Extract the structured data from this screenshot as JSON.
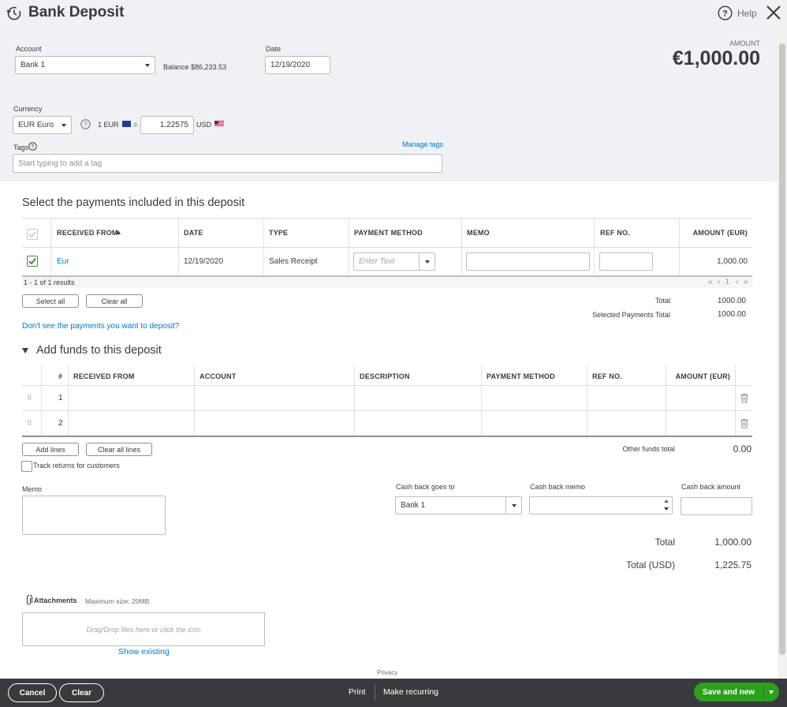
{
  "window": {
    "title": "Bank Deposit",
    "help_label": "Help"
  },
  "header": {
    "account_label": "Account",
    "account_value": "Bank 1",
    "balance_text": "Balance $86,233.53",
    "date_label": "Date",
    "date_value": "12/19/2020",
    "amount_label": "AMOUNT",
    "amount_value": "€1,000.00",
    "currency_label": "Currency",
    "currency_value": "EUR Euro",
    "rate_prefix": "1 EUR",
    "rate_equals": "=",
    "rate_value": "1.22575",
    "rate_suffix": "USD",
    "tags_label": "Tags",
    "manage_tags": "Manage tags",
    "tags_placeholder": "Start typing to add a tag"
  },
  "payments": {
    "title": "Select the payments included in this deposit",
    "columns": [
      "RECEIVED FROM",
      "DATE",
      "TYPE",
      "PAYMENT METHOD",
      "MEMO",
      "REF NO.",
      "AMOUNT (EUR)"
    ],
    "rows": [
      {
        "received_from": "Eur",
        "date": "12/19/2020",
        "type": "Sales Receipt",
        "payment_method_placeholder": "Enter Text",
        "amount": "1,000.00"
      }
    ],
    "results_text": "1 - 1 of 1 results",
    "pager": {
      "first": "«",
      "prev": "‹",
      "page": "1",
      "next": "›",
      "last": "»"
    },
    "select_all": "Select all",
    "clear_all": "Clear all",
    "total_label": "Total",
    "total_value": "1000.00",
    "selected_total_label": "Selected Payments Total",
    "selected_total_value": "1000.00",
    "missing_link": "Don't see the payments you want to deposit?"
  },
  "funds": {
    "title": "Add funds to this deposit",
    "columns": [
      "#",
      "RECEIVED FROM",
      "ACCOUNT",
      "DESCRIPTION",
      "PAYMENT METHOD",
      "REF NO.",
      "AMOUNT (EUR)"
    ],
    "rows": [
      {
        "num": "1"
      },
      {
        "num": "2"
      }
    ],
    "add_lines": "Add lines",
    "clear_all_lines": "Clear all lines",
    "other_total_label": "Other funds total",
    "other_total_value": "0.00",
    "track_returns": "Track returns for customers"
  },
  "bottom": {
    "memo_label": "Memo",
    "cash_back_to_label": "Cash back goes to",
    "cash_back_to_value": "Bank 1",
    "cash_back_memo_label": "Cash back memo",
    "cash_back_amount_label": "Cash back amount",
    "total_label": "Total",
    "total_value": "1,000.00",
    "total_usd_label": "Total (USD)",
    "total_usd_value": "1,225.75",
    "attachments_label": "Attachments",
    "max_size": "Maximum size: 20MB",
    "drop_text": "Drag/Drop files here or click the icon",
    "show_existing": "Show existing",
    "privacy": "Privacy"
  },
  "footer": {
    "cancel": "Cancel",
    "clear": "Clear",
    "print": "Print",
    "make_recurring": "Make recurring",
    "save_new": "Save and new"
  },
  "colors": {
    "accent_green": "#2ca01c",
    "link_blue": "#0077c5",
    "footer_bg": "#393a3d",
    "header_bg": "#eff1f4"
  }
}
